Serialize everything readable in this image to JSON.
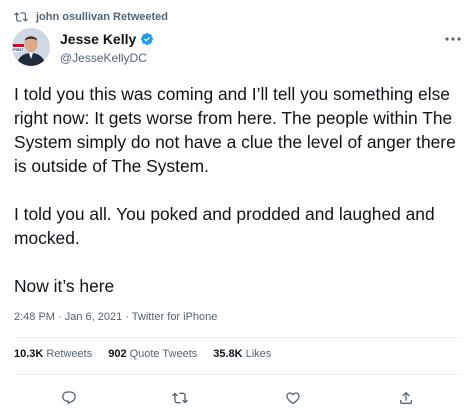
{
  "retweet_context": {
    "icon": "retweet-icon",
    "text": "john osullivan Retweeted"
  },
  "author": {
    "name": "Jesse Kelly",
    "handle": "@JesseKellyDC",
    "verified_icon": "verified-badge-icon",
    "avatar_badge": "FIRST"
  },
  "tweet": {
    "paragraphs": [
      "I told you this was coming and I’ll tell you something else right now: It gets worse from here. The people within The System simply do not have a clue the level of anger there is outside of The System.",
      "I told you all. You poked and prodded and laughed and mocked.",
      "Now it’s here"
    ],
    "timestamp": "2:48 PM · Jan 6, 2021 · Twitter for iPhone"
  },
  "stats": {
    "retweets_count": "10.3K",
    "retweets_label": "Retweets",
    "quotes_count": "902",
    "quotes_label": "Quote Tweets",
    "likes_count": "35.8K",
    "likes_label": "Likes"
  },
  "actions": [
    "reply-icon",
    "retweet-icon",
    "like-icon",
    "share-icon"
  ],
  "colors": {
    "text": "#0f1419",
    "secondary": "#536471",
    "verified": "#1d9bf0",
    "divider": "#eff3f4"
  }
}
